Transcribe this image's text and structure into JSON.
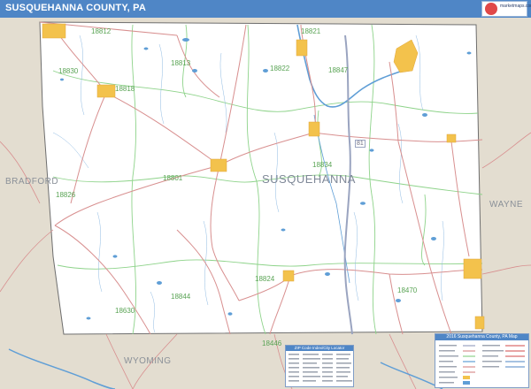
{
  "title": "SUSQUEHANNA COUNTY, PA",
  "logo": {
    "text": "marketmaps.com"
  },
  "map": {
    "county_label": "SUSQUEHANNA",
    "neighbors": {
      "bradford": "BRADFORD",
      "wayne": "WAYNE",
      "wyoming": "WYOMING"
    },
    "zips": [
      "18812",
      "18821",
      "18830",
      "18813",
      "18822",
      "18847",
      "18818",
      "18834",
      "18801",
      "18826",
      "18824",
      "18844",
      "18470",
      "18630",
      "18446"
    ],
    "road_number": "81"
  },
  "colors": {
    "title_bar": "#4f86c6",
    "county_fill": "#ffffff",
    "surrounding": "#e3ddd0",
    "road": "#d88f8f",
    "zip_boundary": "#8ed38a",
    "water": "#5f9ed6",
    "town": "#f3c24c",
    "interstate": "#9aa4c0"
  },
  "legend": {
    "title": "2016 Susquehanna County, PA Map"
  },
  "zip_index": {
    "title": "ZIP Code Index/City Locator"
  }
}
